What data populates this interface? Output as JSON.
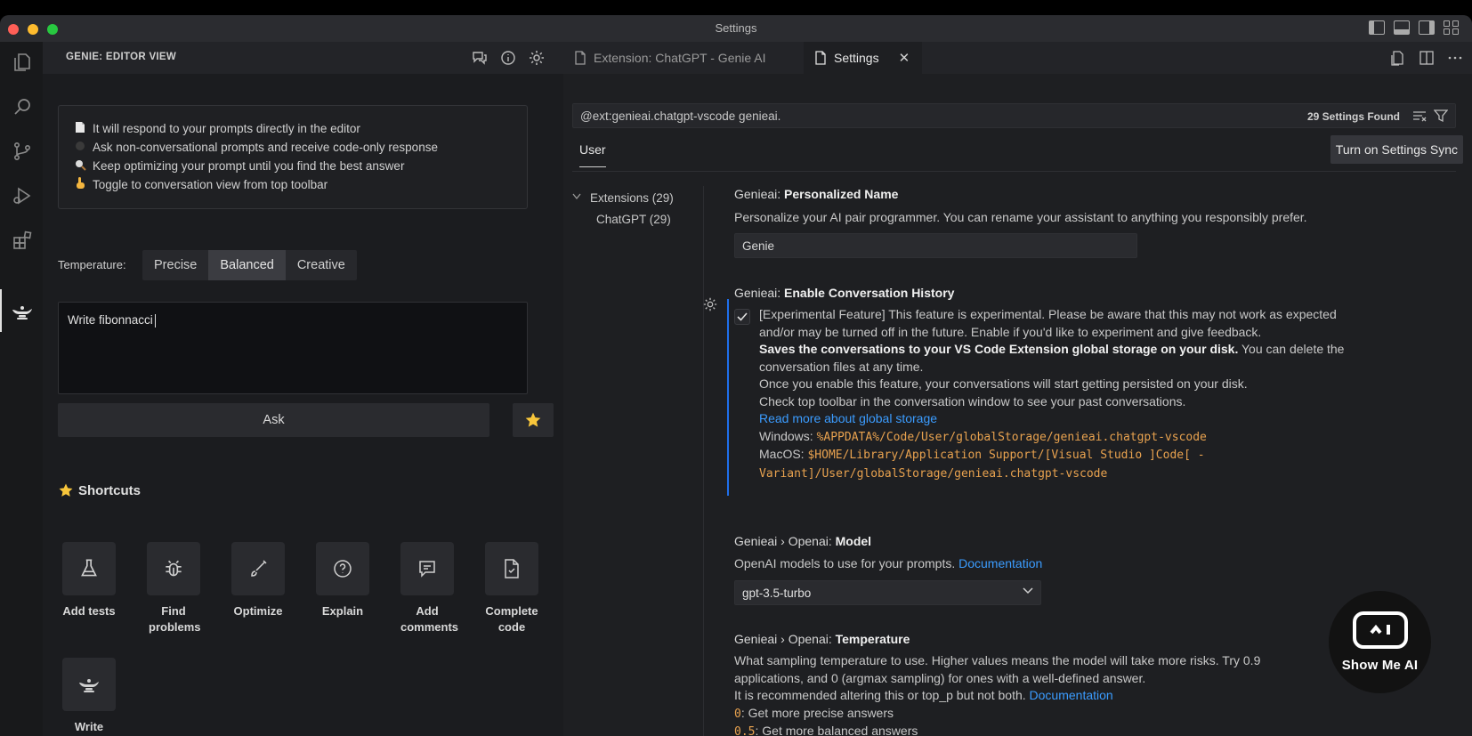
{
  "window": {
    "title": "Settings"
  },
  "left_panel": {
    "title": "GENIE: EDITOR VIEW",
    "info_lines": [
      {
        "icon": "page-icon",
        "text": "It will respond to your prompts directly in the editor"
      },
      {
        "icon": "circle-icon",
        "text": "Ask non-conversational prompts and receive code-only response"
      },
      {
        "icon": "magnifier-icon",
        "text": "Keep optimizing your prompt until you find the best answer"
      },
      {
        "icon": "pointing-hand-icon",
        "text": "Toggle to conversation view from top toolbar"
      }
    ],
    "temperature": {
      "label": "Temperature:",
      "options": [
        "Precise",
        "Balanced",
        "Creative"
      ],
      "selected": "Balanced"
    },
    "prompt_value": "Write fibonnacci",
    "ask_label": "Ask",
    "shortcuts_title": "Shortcuts",
    "shortcuts": [
      {
        "icon": "flask-icon",
        "label": "Add tests"
      },
      {
        "icon": "bug-icon",
        "label": "Find problems"
      },
      {
        "icon": "brush-icon",
        "label": "Optimize"
      },
      {
        "icon": "question-icon",
        "label": "Explain"
      },
      {
        "icon": "comment-icon",
        "label": "Add comments"
      },
      {
        "icon": "file-check-icon",
        "label": "Complete code"
      },
      {
        "icon": "genie-lamp-icon",
        "label": "Write Dijkstra's"
      }
    ]
  },
  "tabs": [
    {
      "label": "Extension: ChatGPT - Genie AI",
      "active": false
    },
    {
      "label": "Settings",
      "active": true
    }
  ],
  "settings_view": {
    "search_value": "@ext:genieai.chatgpt-vscode genieai.",
    "results_count": "29 Settings Found",
    "scope_tab": "User",
    "sync_button": "Turn on Settings Sync",
    "tree": [
      {
        "label": "Extensions (29)",
        "expanded": true
      },
      {
        "label": "ChatGPT (29)"
      }
    ],
    "personalized_name": {
      "prefix": "Genieai: ",
      "name": "Personalized Name",
      "description": "Personalize your AI pair programmer. You can rename your assistant to anything you responsibly prefer.",
      "value": "Genie"
    },
    "conversation_history": {
      "prefix": "Genieai: ",
      "name": "Enable Conversation History",
      "checked": true,
      "line1": "[Experimental Feature] This feature is experimental. Please be aware that this may not work as expected",
      "line2": "and/or may be turned off in the future. Enable if you'd like to experiment and give feedback.",
      "line3_bold": "Saves the conversations to your VS Code Extension global storage on your disk.",
      "line3_rest": " You can delete the",
      "line4": "conversation files at any time.",
      "line5": "Once you enable this feature, your conversations will start getting persisted on your disk.",
      "line6": "Check top toolbar in the conversation window to see your past conversations.",
      "link": "Read more about global storage",
      "windows_label": "Windows: ",
      "windows_path": "%APPDATA%/Code/User/globalStorage/genieai.chatgpt-vscode",
      "macos_label": "MacOS: ",
      "macos_path1": "$HOME/Library/Application Support/[Visual Studio ]Code[ -",
      "macos_path2": "Variant]/User/globalStorage/genieai.chatgpt-vscode"
    },
    "model": {
      "prefix": "Genieai › Openai: ",
      "name": "Model",
      "description": "OpenAI models to use for your prompts. ",
      "link": "Documentation",
      "value": "gpt-3.5-turbo"
    },
    "temperature": {
      "prefix": "Genieai › Openai: ",
      "name": "Temperature",
      "line1": "What sampling temperature to use. Higher values means the model will take more risks. Try 0.9",
      "line2": "applications, and 0 (argmax sampling) for ones with a well-defined answer.",
      "line3": "It is recommended altering this or top_p but not both. ",
      "link": "Documentation",
      "opt0_value": "0",
      "opt0_text": ": Get more precise answers",
      "opt1_value": "0.5",
      "opt1_text": ": Get more balanced answers"
    }
  },
  "watermark": {
    "text": "Show Me AI"
  },
  "colors": {
    "accent": "#1f6feb",
    "link": "#3b9cff",
    "code": "#e8a24f"
  }
}
